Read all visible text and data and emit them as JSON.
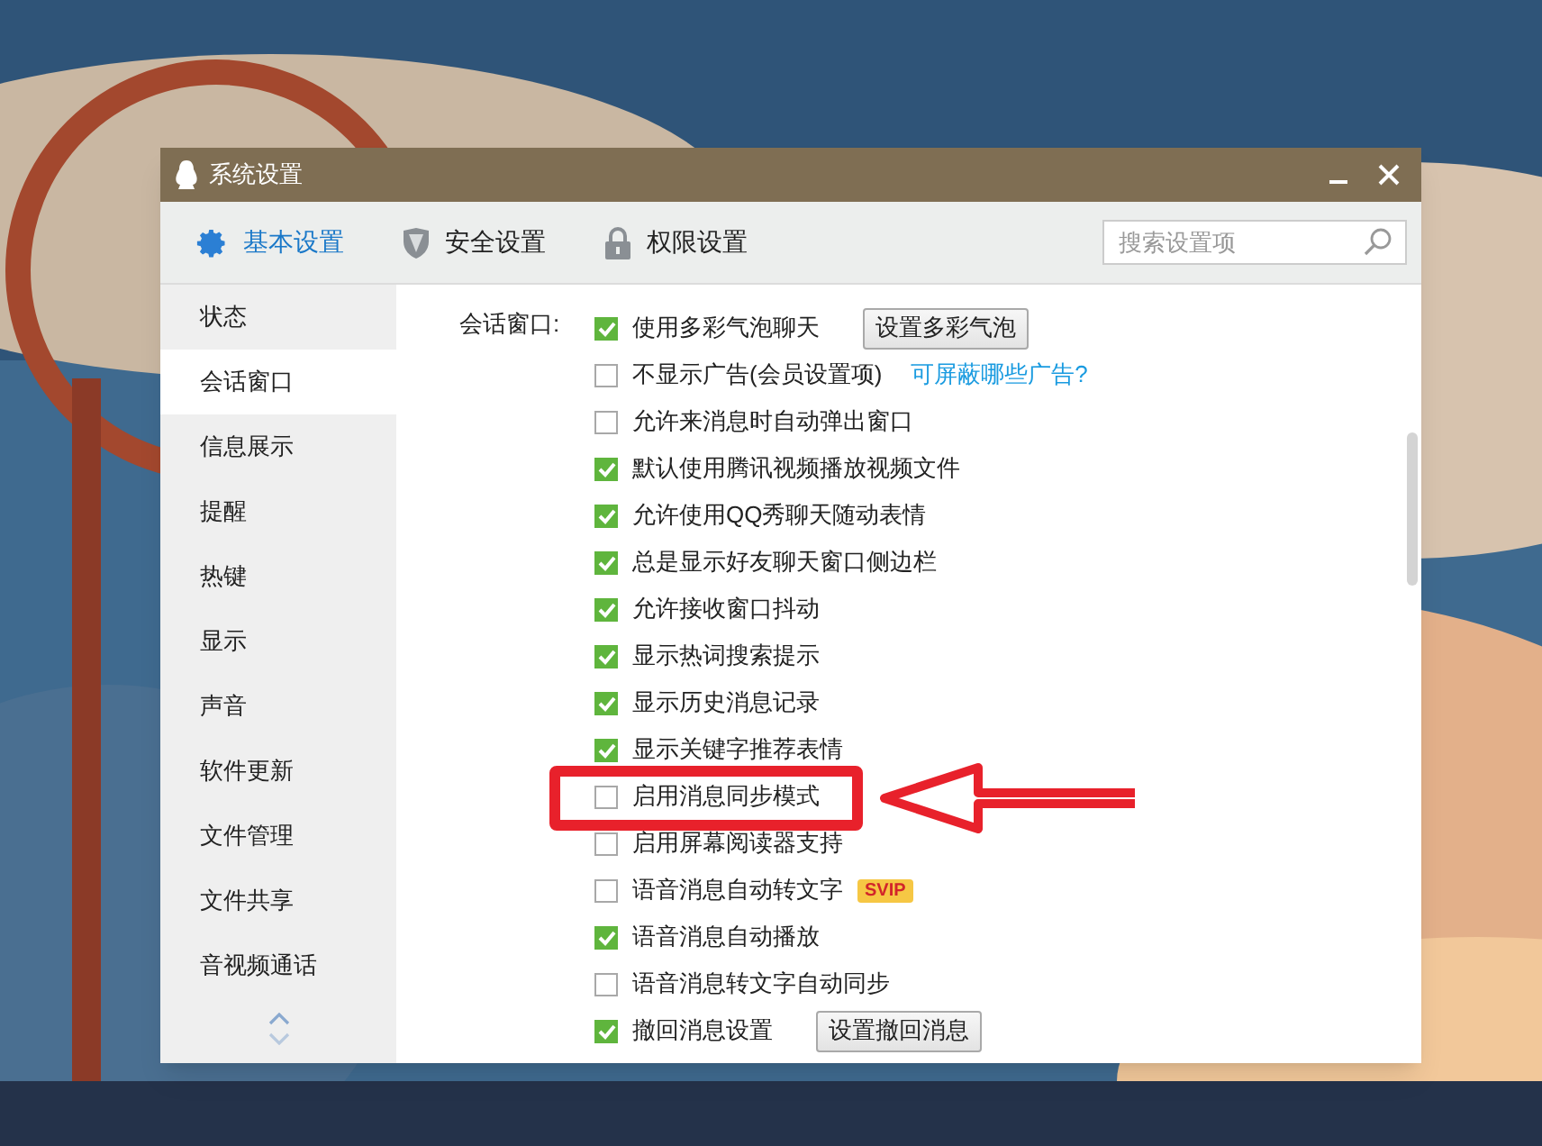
{
  "window": {
    "title": "系统设置"
  },
  "tabs": [
    {
      "label": "基本设置",
      "kind": "gear",
      "selected": true
    },
    {
      "label": "安全设置",
      "kind": "shield",
      "selected": false
    },
    {
      "label": "权限设置",
      "kind": "lock",
      "selected": false
    }
  ],
  "search": {
    "placeholder": "搜索设置项"
  },
  "sidebar": {
    "items": [
      {
        "label": "状态",
        "selected": false
      },
      {
        "label": "会话窗口",
        "selected": true
      },
      {
        "label": "信息展示",
        "selected": false
      },
      {
        "label": "提醒",
        "selected": false
      },
      {
        "label": "热键",
        "selected": false
      },
      {
        "label": "显示",
        "selected": false
      },
      {
        "label": "声音",
        "selected": false
      },
      {
        "label": "软件更新",
        "selected": false
      },
      {
        "label": "文件管理",
        "selected": false
      },
      {
        "label": "文件共享",
        "selected": false
      },
      {
        "label": "音视频通话",
        "selected": false
      }
    ]
  },
  "section": {
    "label": "会话窗口:",
    "options": [
      {
        "label": "使用多彩气泡聊天",
        "checked": true,
        "extra": {
          "kind": "button",
          "label": "设置多彩气泡"
        }
      },
      {
        "label": "不显示广告(会员设置项)",
        "checked": false,
        "extra": {
          "kind": "link",
          "label": "可屏蔽哪些广告?"
        }
      },
      {
        "label": "允许来消息时自动弹出窗口",
        "checked": false
      },
      {
        "label": "默认使用腾讯视频播放视频文件",
        "checked": true
      },
      {
        "label": "允许使用QQ秀聊天随动表情",
        "checked": true
      },
      {
        "label": "总是显示好友聊天窗口侧边栏",
        "checked": true
      },
      {
        "label": "允许接收窗口抖动",
        "checked": true
      },
      {
        "label": "显示热词搜索提示",
        "checked": true
      },
      {
        "label": "显示历史消息记录",
        "checked": true
      },
      {
        "label": "显示关键字推荐表情",
        "checked": true
      },
      {
        "label": "启用消息同步模式",
        "checked": false
      },
      {
        "label": "启用屏幕阅读器支持",
        "checked": false
      },
      {
        "label": "语音消息自动转文字",
        "checked": false,
        "extra": {
          "kind": "badge",
          "label": "SVIP"
        }
      },
      {
        "label": "语音消息自动播放",
        "checked": true
      },
      {
        "label": "语音消息转文字自动同步",
        "checked": false
      },
      {
        "label": "撤回消息设置",
        "checked": true,
        "extra": {
          "kind": "button",
          "label": "设置撤回消息"
        }
      }
    ]
  }
}
